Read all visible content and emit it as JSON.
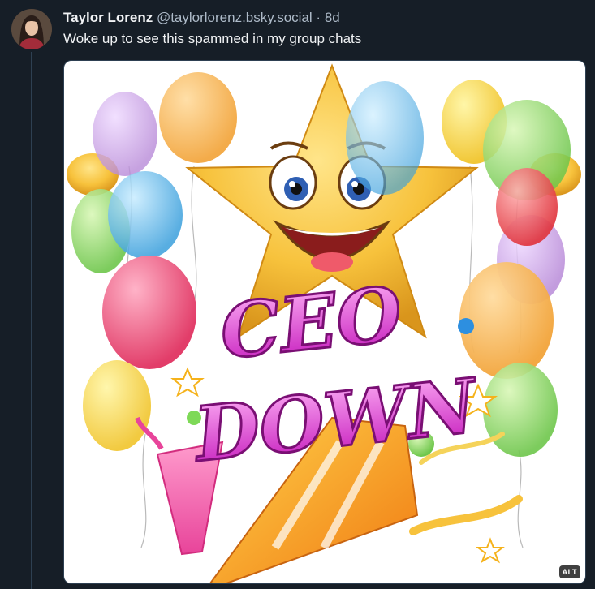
{
  "post": {
    "author": "Taylor Lorenz",
    "handle": "@taylorlorenz.bsky.social",
    "separator": "·",
    "time": "8d",
    "text": "Woke up to see this spammed in my group chats"
  },
  "image": {
    "line1": "CEO",
    "line2": "DOWN",
    "alt_label": "ALT"
  },
  "colors": {
    "background": "#161e27",
    "muted": "#aebbc9",
    "text": "#f1f3f5",
    "ceo_text": "#d92fd0"
  }
}
